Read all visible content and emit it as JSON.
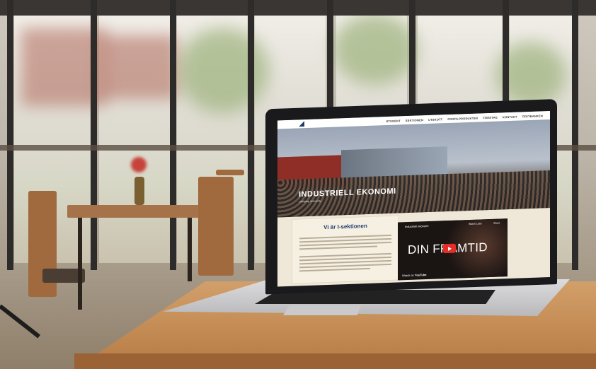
{
  "website": {
    "nav": [
      "STUDENT",
      "SEKTIONEN",
      "UTSKOTT",
      "PROFILPRODUKTER",
      "FÖRETAG",
      "KONTAKT",
      "TESTBANKEN"
    ],
    "hero_title": "INDUSTRIELL EKONOMI",
    "hero_subtitle": "Linköping University",
    "section_heading": "Vi är I-sektionen",
    "video": {
      "title": "Industriell ekonomi",
      "overlay_text": "DIN FRAMTID",
      "watch_later": "Watch Later",
      "share": "Share",
      "watch_on": "Watch on",
      "youtube": "YouTube"
    }
  },
  "colors": {
    "desk": "#c58d56",
    "laptop_bezel": "#1a1a1c",
    "laptop_body": "#cfcfd2",
    "brand_blue": "#1d3b6e",
    "youtube_red": "#e52d27"
  }
}
